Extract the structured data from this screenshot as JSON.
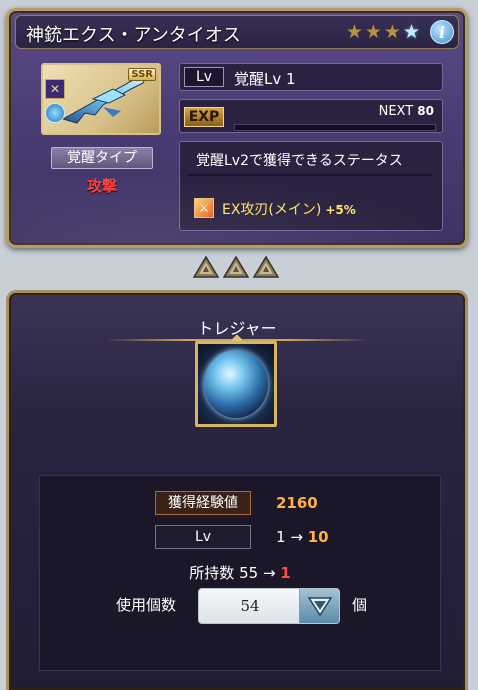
{
  "weapon": {
    "name": "神銃エクス・アンタイオス",
    "rarity_badge": "SSR",
    "stars": [
      "star-gold",
      "star-gold",
      "star-gold",
      "star-blue"
    ],
    "level_tag": "Lv",
    "level_text": "覚醒Lv 1",
    "exp_tag": "EXP",
    "next_label": "NEXT",
    "next_value": "80",
    "exp_progress": 0,
    "awakening_type_label": "覚醒タイプ",
    "awakening_type_value": "攻撃",
    "status_title": "覚醒Lv2で獲得できるステータス",
    "status_effect": "EX攻刃(メイン)",
    "status_bonus": "+5%"
  },
  "treasure": {
    "title": "トレジャー",
    "exp_gain_label": "獲得経験値",
    "exp_gain_value": "2160",
    "lv_label": "Lv",
    "lv_from": "1",
    "lv_arrow": "→",
    "lv_to": "10",
    "owned_label": "所持数",
    "owned_from": "55",
    "owned_arrow": "→",
    "owned_to": "1",
    "use_label": "使用個数",
    "use_value": "54",
    "use_unit": "個"
  },
  "colors": {
    "accent_gold": "#d7b663",
    "attack_red": "#ff4040",
    "exp_orange": "#ffb048",
    "bonus_yellow": "#ffe566"
  }
}
